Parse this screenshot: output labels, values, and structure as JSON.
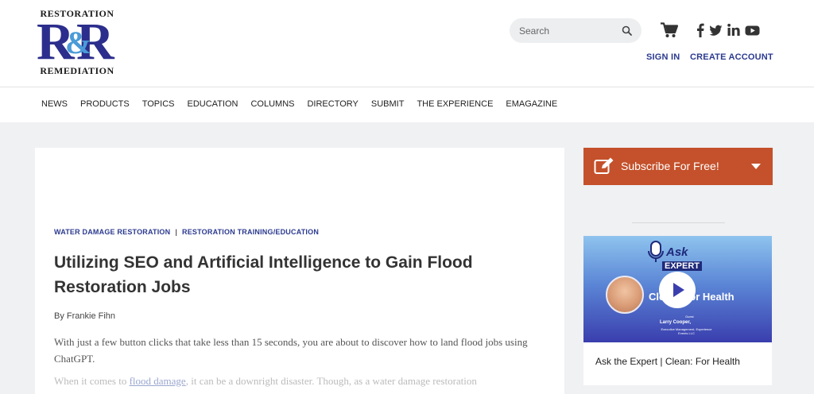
{
  "logo": {
    "top_word": "RESTORATION",
    "mark_left": "R",
    "mark_amp": "&",
    "mark_right": "R",
    "bottom_word": "REMEDIATION"
  },
  "header": {
    "search_placeholder": "Search",
    "sign_in": "SIGN IN",
    "create_account": "CREATE ACCOUNT",
    "icons": [
      "search-icon",
      "cart-icon",
      "facebook-icon",
      "twitter-icon",
      "linkedin-icon",
      "youtube-icon"
    ]
  },
  "nav": {
    "items": [
      "NEWS",
      "PRODUCTS",
      "TOPICS",
      "EDUCATION",
      "COLUMNS",
      "DIRECTORY",
      "SUBMIT",
      "THE EXPERIENCE",
      "EMAGAZINE"
    ]
  },
  "article": {
    "categories": [
      "WATER DAMAGE RESTORATION",
      "RESTORATION TRAINING/EDUCATION"
    ],
    "category_separator": "|",
    "title": "Utilizing SEO and Artificial Intelligence to Gain Flood Restoration Jobs",
    "byline": "By Frankie Fihn",
    "intro": "With just a few button clicks that take less than 15 seconds, you are about to discover how to land flood jobs using ChatGPT.",
    "p2_before": "When it comes to ",
    "p2_link": "flood damage",
    "p2_after": ", it can be a downright disaster. Though, as a water damage restoration"
  },
  "sidebar": {
    "subscribe_label": "Subscribe For Free!",
    "video": {
      "ask_label": "Ask",
      "expert_label": "EXPERT",
      "topic_text": "Clean: For Health",
      "guest_label": "Guest",
      "guest_name": "Larry Cooper,",
      "guest_role": "Executive Management, Experience Events LLC",
      "caption": "Ask the Expert | Clean: For Health"
    }
  },
  "colors": {
    "brand_navy": "#2b3a8f",
    "subscribe_bg": "#c4512b",
    "logo_blue": "#2b2e8c",
    "logo_amp": "#4a9bd8"
  }
}
